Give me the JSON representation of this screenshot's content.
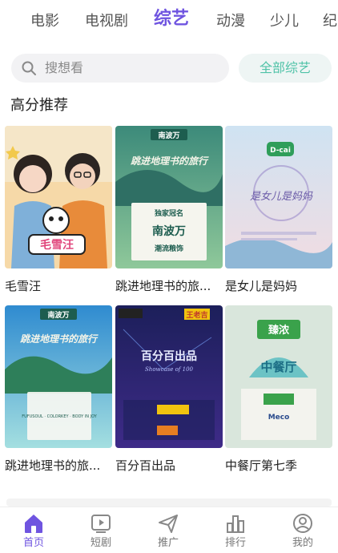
{
  "tabs": [
    {
      "label": "电影"
    },
    {
      "label": "电视剧"
    },
    {
      "label": "综艺",
      "active": true
    },
    {
      "label": "动漫"
    },
    {
      "label": "少儿"
    },
    {
      "label": "纪"
    }
  ],
  "search": {
    "placeholder": "搜想看",
    "all_button": "全部综艺"
  },
  "section": {
    "title": "高分推荐"
  },
  "cards": [
    {
      "title": "毛雪汪",
      "poster_text": "毛雪汪"
    },
    {
      "title": "跳进地理书的旅...",
      "poster_text": "跳进地理书的旅行",
      "badge": "南波万",
      "sponsor_label": "独家冠名",
      "sponsor": "南波万",
      "sponsor_sub": "潮流粮饰"
    },
    {
      "title": "是女儿是妈妈",
      "poster_text": "是女儿是妈妈",
      "badge": "D-cai"
    },
    {
      "title": "跳进地理书的旅...",
      "poster_text": "跳进地理书的旅行",
      "badge": "南波万",
      "sponsor_sub": "FUFUSOUL · COLORKEY · BODY IN JOY"
    },
    {
      "title": "百分百出品",
      "poster_text": "百分百出品",
      "badge": "王老吉",
      "sub": "Showcase of 100"
    },
    {
      "title": "中餐厅第七季",
      "poster_text": "中餐厅",
      "badge": "臻浓",
      "sponsor_sub": "Meco"
    }
  ],
  "nav": [
    {
      "label": "首页",
      "active": true,
      "icon": "home-icon"
    },
    {
      "label": "短剧",
      "icon": "play-icon"
    },
    {
      "label": "推广",
      "icon": "send-icon"
    },
    {
      "label": "排行",
      "icon": "bar-chart-icon"
    },
    {
      "label": "我的",
      "icon": "profile-icon"
    }
  ],
  "colors": {
    "accent": "#6f54e0",
    "teal": "#4fc2a7"
  }
}
